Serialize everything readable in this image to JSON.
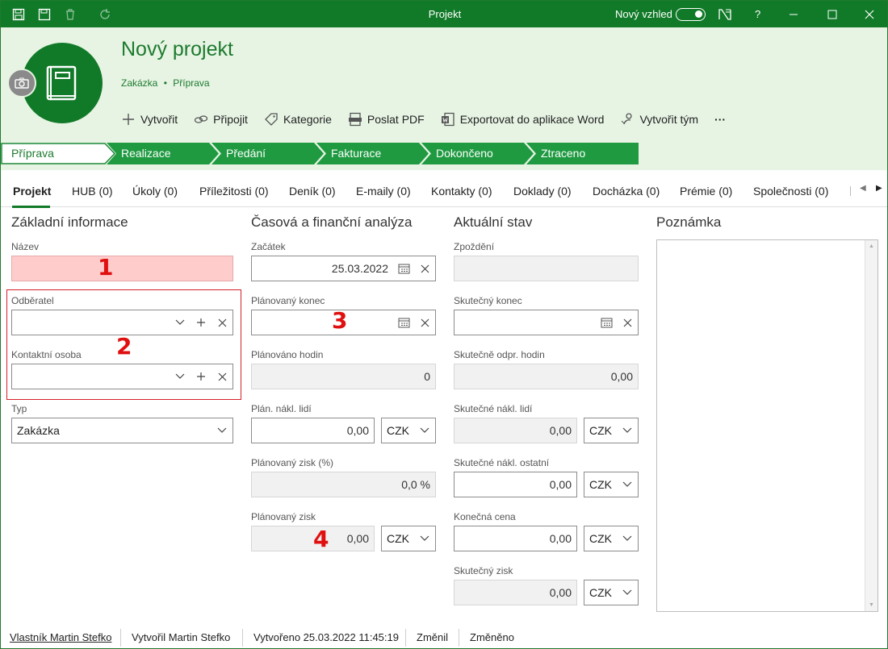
{
  "window": {
    "title": "Projekt",
    "new_look_label": "Nový vzhled",
    "help": "?"
  },
  "header": {
    "title": "Nový projekt",
    "crumb_type": "Zakázka",
    "crumb_sep": "•",
    "crumb_stage": "Příprava",
    "actions": [
      "Vytvořit",
      "Připojit",
      "Kategorie",
      "Poslat PDF",
      "Exportovat do aplikace Word",
      "Vytvořit tým"
    ],
    "more": "···"
  },
  "stages": [
    "Příprava",
    "Realizace",
    "Předání",
    "Fakturace",
    "Dokončeno",
    "Ztraceno"
  ],
  "tabs": [
    "Projekt",
    "HUB (0)",
    "Úkoly (0)",
    "Příležitosti (0)",
    "Deník (0)",
    "E-maily (0)",
    "Kontakty (0)",
    "Doklady (0)",
    "Docházka (0)",
    "Prémie (0)",
    "Společnosti (0)"
  ],
  "basic": {
    "title": "Základní informace",
    "name_label": "Název",
    "customer_label": "Odběratel",
    "contact_label": "Kontaktní osoba",
    "type_label": "Typ",
    "type_value": "Zakázka"
  },
  "analysis": {
    "title": "Časová a finanční analýza",
    "start_label": "Začátek",
    "start_value": "25.03.2022",
    "planned_end_label": "Plánovaný konec",
    "planned_hours_label": "Plánováno hodin",
    "planned_hours_value": "0",
    "planned_staff_cost_label": "Plán. nákl. lidí",
    "planned_staff_cost_value": "0,00",
    "planned_profit_pct_label": "Plánovaný zisk (%)",
    "planned_profit_pct_value": "0,0 %",
    "planned_profit_label": "Plánovaný zisk",
    "planned_profit_value": "0,00",
    "currency": "CZK"
  },
  "status": {
    "title": "Aktuální stav",
    "delay_label": "Zpoždění",
    "actual_end_label": "Skutečný konec",
    "actual_hours_label": "Skutečně odpr. hodin",
    "actual_hours_value": "0,00",
    "actual_staff_cost_label": "Skutečné nákl. lidí",
    "actual_staff_cost_value": "0,00",
    "actual_other_cost_label": "Skutečné nákl. ostatní",
    "actual_other_cost_value": "0,00",
    "final_price_label": "Konečná cena",
    "final_price_value": "0,00",
    "actual_profit_label": "Skutečný zisk",
    "actual_profit_value": "0,00",
    "currency": "CZK"
  },
  "note": {
    "title": "Poznámka"
  },
  "markers": [
    "1",
    "2",
    "3",
    "4"
  ],
  "footer": {
    "owner": "Vlastník Martin Stefko",
    "created_by": "Vytvořil Martin Stefko",
    "created": "Vytvořeno 25.03.2022 11:45:19",
    "changed_by": "Změnil",
    "changed": "Změněno"
  },
  "colors": {
    "brand": "#117a28",
    "header_bg": "#e7f4e4",
    "required_bg": "#ffcccc",
    "marker": "#e01010"
  }
}
